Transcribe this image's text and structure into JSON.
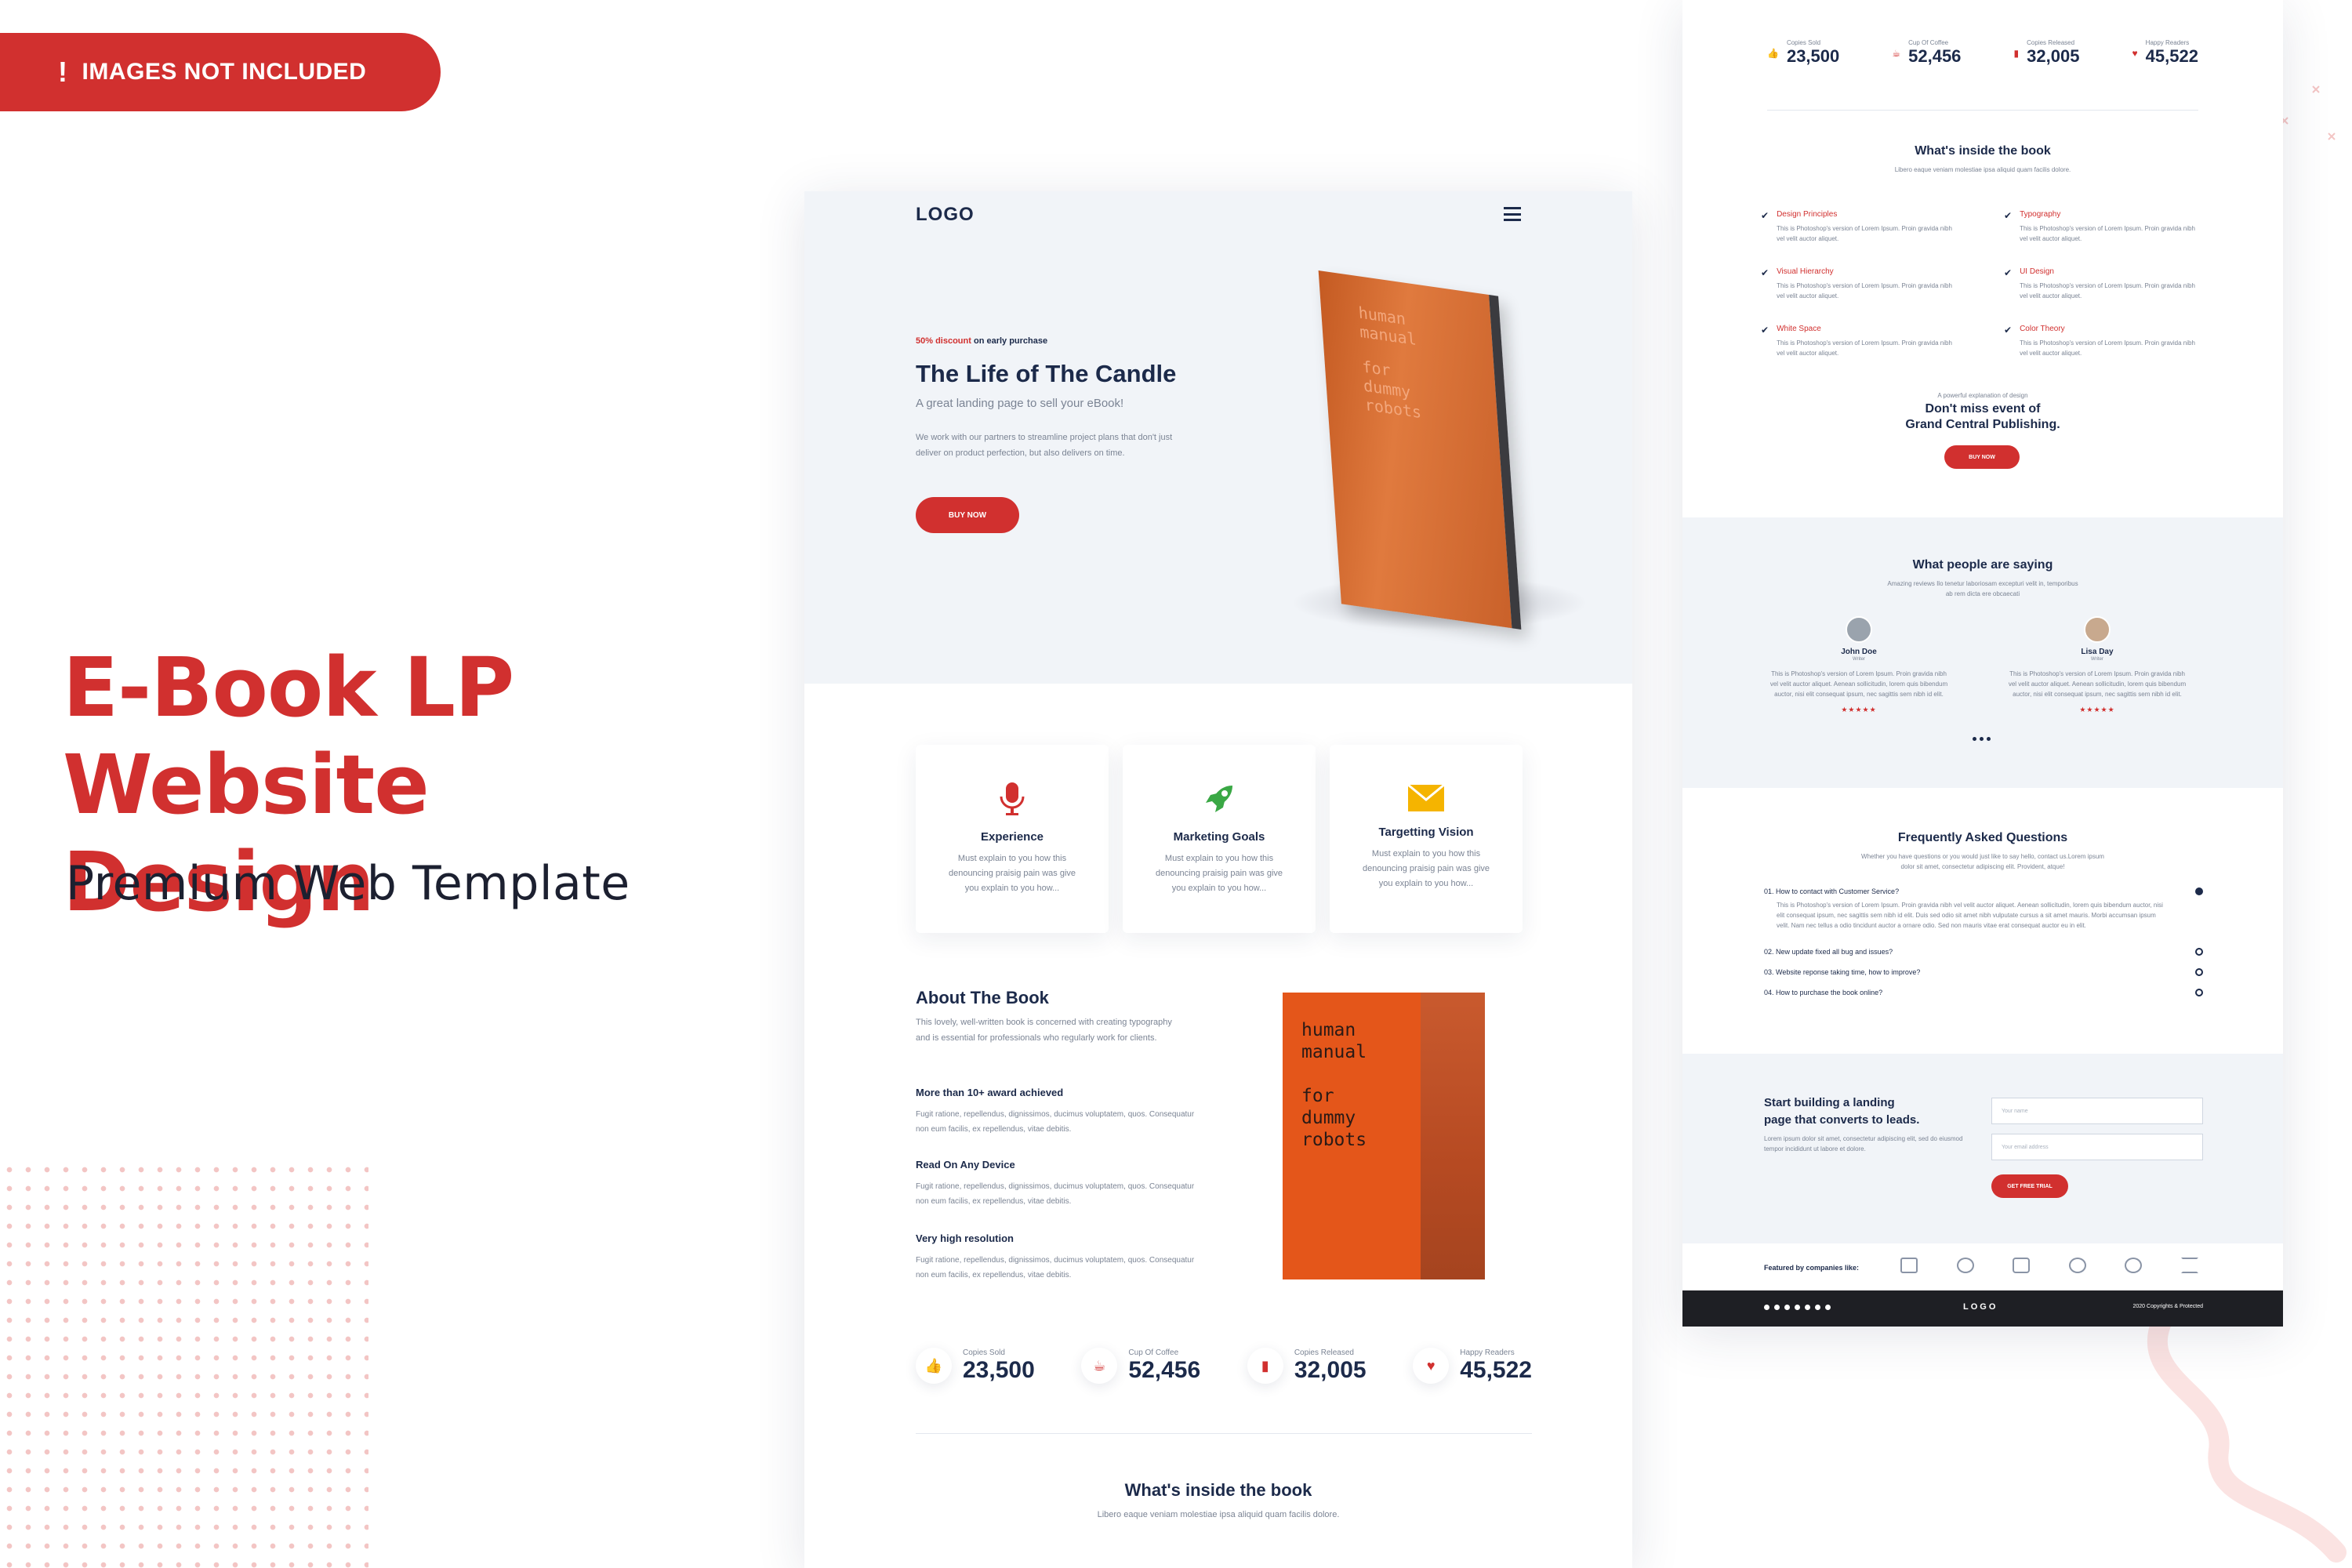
{
  "banner": {
    "icon": "exclamation-icon",
    "text": "IMAGES NOT INCLUDED"
  },
  "hero": {
    "title_line1": "E-Book LP",
    "title_line2": "Website Design",
    "subtitle": "Premium Web Template"
  },
  "colors": {
    "accent": "#d1302f",
    "navy": "#1c2a4a",
    "light_bg": "#f1f4f8",
    "book_orange": "#e4561a"
  },
  "page1": {
    "logo": "LOGO",
    "hero": {
      "discount_red": "50% discount",
      "discount_rest": "on early purchase",
      "title": "The Life of The Candle",
      "tagline": "A great landing page to sell your eBook!",
      "body": "We work with our partners to streamline project plans that don't just deliver on product perfection, but also delivers on time.",
      "button": "BUY NOW"
    },
    "book_cover_lines": [
      "human",
      "manual",
      "for",
      "dummy",
      "robots"
    ],
    "features": [
      {
        "icon": "microphone-icon",
        "title": "Experience",
        "text": "Must explain to you how this denouncing praisig pain was give you explain to you how..."
      },
      {
        "icon": "rocket-icon",
        "title": "Marketing Goals",
        "text": "Must explain to you how this denouncing praisig pain was give you explain to you how..."
      },
      {
        "icon": "envelope-icon",
        "title": "Targetting Vision",
        "text": "Must explain to you how this denouncing praisig pain was give you explain to you how..."
      }
    ],
    "about": {
      "title": "About The Book",
      "intro": "This lovely, well-written book is concerned with creating typography and is essential for professionals who regularly work for clients.",
      "points": [
        {
          "title": "More than 10+ award achieved",
          "text": "Fugit ratione, repellendus, dignissimos, ducimus voluptatem, quos. Consequatur non eum facilis, ex repellendus, vitae debitis."
        },
        {
          "title": "Read On Any Device",
          "text": "Fugit ratione, repellendus, dignissimos, ducimus voluptatem, quos. Consequatur non eum facilis, ex repellendus, vitae debitis."
        },
        {
          "title": "Very high resolution",
          "text": "Fugit ratione, repellendus, dignissimos, ducimus voluptatem, quos. Consequatur non eum facilis, ex repellendus, vitae debitis."
        }
      ]
    },
    "stats": [
      {
        "icon": "thumbs-up-icon",
        "label": "Copies Sold",
        "value": "23,500"
      },
      {
        "icon": "coffee-icon",
        "label": "Cup Of Coffee",
        "value": "52,456"
      },
      {
        "icon": "bookmark-icon",
        "label": "Copies Released",
        "value": "32,005"
      },
      {
        "icon": "heart-icon",
        "label": "Happy Readers",
        "value": "45,522"
      }
    ],
    "inside": {
      "title": "What's inside the book",
      "subtitle": "Libero eaque veniam molestiae ipsa aliquid quam facilis dolore."
    }
  },
  "page2": {
    "stats": [
      {
        "icon": "thumbs-up-icon",
        "label": "Copies Sold",
        "value": "23,500"
      },
      {
        "icon": "coffee-icon",
        "label": "Cup Of Coffee",
        "value": "52,456"
      },
      {
        "icon": "bookmark-icon",
        "label": "Copies Released",
        "value": "32,005"
      },
      {
        "icon": "heart-icon",
        "label": "Happy Readers",
        "value": "45,522"
      }
    ],
    "inside": {
      "title": "What's inside the book",
      "subtitle": "Libero eaque veniam molestiae ipsa aliquid quam facilis dolore.",
      "items": [
        {
          "title": "Design Principles",
          "text": "This is Photoshop's version of Lorem Ipsum. Proin gravida nibh vel velit auctor aliquet."
        },
        {
          "title": "Typography",
          "text": "This is Photoshop's version of Lorem Ipsum. Proin gravida nibh vel velit auctor aliquet."
        },
        {
          "title": "Visual Hierarchy",
          "text": "This is Photoshop's version of Lorem Ipsum. Proin gravida nibh vel velit auctor aliquet."
        },
        {
          "title": "UI Design",
          "text": "This is Photoshop's version of Lorem Ipsum. Proin gravida nibh vel velit auctor aliquet."
        },
        {
          "title": "White Space",
          "text": "This is Photoshop's version of Lorem Ipsum. Proin gravida nibh vel velit auctor aliquet."
        },
        {
          "title": "Color Theory",
          "text": "This is Photoshop's version of Lorem Ipsum. Proin gravida nibh vel velit auctor aliquet."
        }
      ]
    },
    "cta": {
      "kicker": "A powerful explanation of design",
      "title_line1": "Don't miss event of",
      "title_line2": "Grand Central Publishing.",
      "button": "BUY NOW"
    },
    "testimonials": {
      "title": "What people are saying",
      "subtitle_line1": "Amazing reviews Ilo tenetur laboriosam excepturi velit in, temporibus",
      "subtitle_line2": "ab rem dicta ere obcaecati",
      "people": [
        {
          "name": "John Doe",
          "role": "Writer",
          "text": "This is Photoshop's version of Lorem Ipsum. Proin gravida nibh vel velit auctor aliquet. Aenean sollicitudin, lorem quis bibendum auctor, nisi elit consequat ipsum, nec sagittis sem nibh id elit.",
          "stars": "★★★★★"
        },
        {
          "name": "Lisa Day",
          "role": "Writer",
          "text": "This is Photoshop's version of Lorem Ipsum. Proin gravida nibh vel velit auctor aliquet. Aenean sollicitudin, lorem quis bibendum auctor, nisi elit consequat ipsum, nec sagittis sem nibh id elit.",
          "stars": "★★★★★"
        }
      ]
    },
    "faq": {
      "title": "Frequently Asked Questions",
      "subtitle_line1": "Whether you have questions or you would just like to say hello, contact us.Lorem ipsum",
      "subtitle_line2": "dolor sit amet, consectetur adipiscing elit. Provident, atque!",
      "items": [
        {
          "q": "01. How to contact with Customer Service?",
          "a": "This is Photoshop's version of Lorem Ipsum. Proin gravida nibh vel velit auctor aliquet. Aenean sollicitudin, lorem quis bibendum auctor, nisi elit consequat ipsum, nec sagittis sem nibh id elit. Duis sed odio sit amet nibh vulputate cursus a sit amet mauris. Morbi accumsan ipsum velit. Nam nec tellus a odio tincidunt auctor a ornare odio. Sed non mauris vitae erat consequat auctor eu in elit."
        },
        {
          "q": "02. New update fixed all bug and issues?",
          "a": ""
        },
        {
          "q": "03. Website reponse taking time, how to improve?",
          "a": ""
        },
        {
          "q": "04. How to purchase the book online?",
          "a": ""
        }
      ]
    },
    "signup": {
      "title_line1": "Start building a landing",
      "title_line2": "page that converts to leads.",
      "text": "Lorem ipsum dolor sit amet, consectetur adipiscing elit, sed do eiusmod tempor incididunt ut labore et dolore.",
      "field1_placeholder": "Your name",
      "field2_placeholder": "Your email address",
      "button": "GET FREE TRIAL"
    },
    "partners_label": "Featured by companies like:",
    "footer": {
      "logo": "LOGO",
      "copyright": "2020 Copyrights & Protected"
    }
  }
}
